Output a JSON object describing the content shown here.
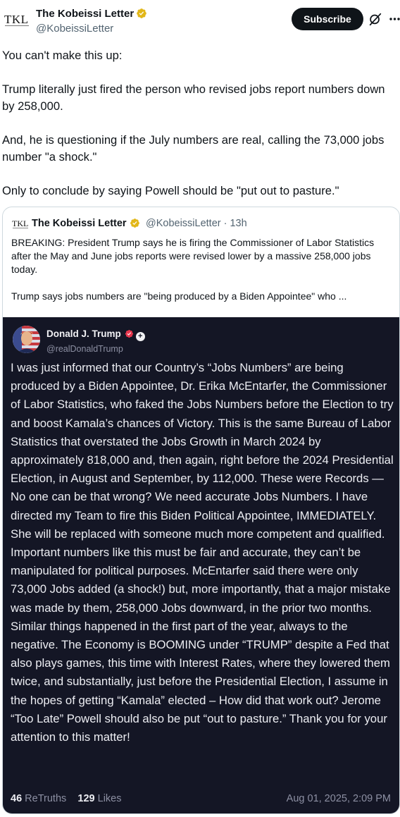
{
  "tweet": {
    "author_name": "The Kobeissi Letter",
    "author_handle": "@KobeissiLetter",
    "logo_text": "TKL",
    "subscribe_label": "Subscribe",
    "paragraphs": [
      "You can't make this up:",
      "Trump literally just fired the person who revised jobs report numbers down by 258,000.",
      "And, he is questioning if the July numbers are real, calling the 73,000 jobs number \"a shock.\"",
      "Only to conclude by saying Powell should be \"put out to pasture.\""
    ]
  },
  "quote": {
    "author_name": "The Kobeissi Letter",
    "handle_time": "@KobeissiLetter · 13h",
    "logo_text": "TKL",
    "paragraphs": [
      "BREAKING: President Trump says he is firing the Commissioner of Labor Statistics after the May and June jobs reports were revised lower by a massive 258,000 jobs today.",
      "Trump says jobs numbers are \"being produced by a Biden Appointee\" who ..."
    ]
  },
  "truth_post": {
    "author_name": "Donald J. Trump",
    "author_handle": "@realDonaldTrump",
    "body": "I was just informed that our Country’s “Jobs Numbers” are being produced by a Biden Appointee, Dr. Erika McEntarfer, the Commissioner of Labor Statistics, who faked the Jobs Numbers before the Election to try and boost Kamala’s chances of Victory. This is the same Bureau of Labor Statistics that overstated the Jobs Growth in March 2024 by approximately 818,000 and, then again, right before the 2024 Presidential Election, in August and September, by 112,000. These were Records — No one can be that wrong? We need accurate Jobs Numbers. I have directed my Team to fire this Biden Political Appointee, IMMEDIATELY. She will be replaced with someone much more competent and qualified. Important numbers like this must be fair and accurate, they can’t be manipulated for political purposes. McEntarfer said there were only 73,000 Jobs added (a shock!) but, more importantly, that a major mistake was made by them, 258,000 Jobs downward, in the prior two months. Similar things happened in the first part of the year, always to the negative. The Economy is BOOMING under “TRUMP” despite a Fed that also plays games, this time with Interest Rates, where they lowered them twice, and substantially, just before the Presidential Election, I assume in the hopes of getting “Kamala” elected – How did that work out? Jerome “Too Late” Powell should also be put “out to pasture.” Thank you for your attention to this matter!",
    "retruths_count": "46",
    "retruths_label": "ReTruths",
    "likes_count": "129",
    "likes_label": "Likes",
    "date": "Aug 01, 2025, 2:09 PM"
  },
  "colors": {
    "verified_gold": "#e2b719",
    "truth_bg": "#141625",
    "subscribe_bg": "#0f1419",
    "truth_badge": "#e5364d"
  },
  "icons": [
    "verified-badge-icon",
    "grok-icon",
    "more-icon",
    "truth-verified-icon",
    "plus-icon"
  ]
}
